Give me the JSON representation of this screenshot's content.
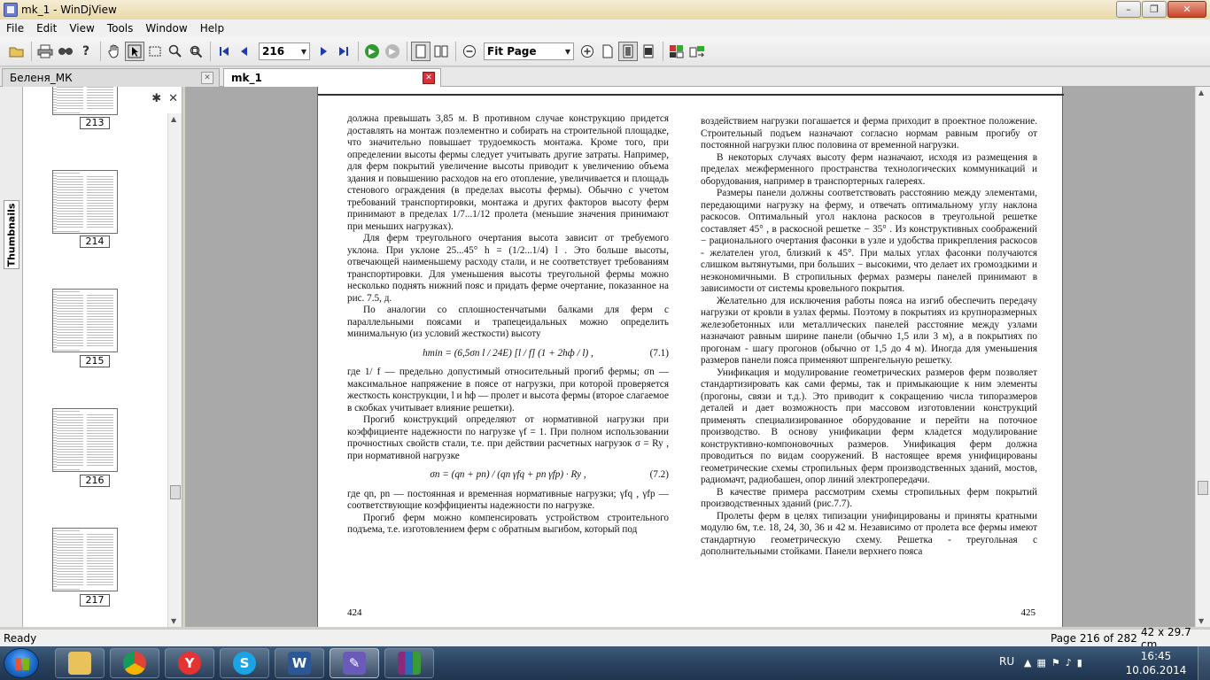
{
  "window": {
    "title": "mk_1 - WinDjView",
    "minimize": "–",
    "restore": "❐",
    "close": "✕"
  },
  "menu": [
    "File",
    "Edit",
    "View",
    "Tools",
    "Window",
    "Help"
  ],
  "toolbar": {
    "page_value": "216",
    "zoom_value": "Fit Page"
  },
  "tabs": [
    {
      "label": "Беленя_МК",
      "active": false
    },
    {
      "label": "mk_1",
      "active": true
    }
  ],
  "sidebar": {
    "tab_label": "Thumbnails",
    "thumbnails": [
      "213",
      "214",
      "215",
      "216",
      "217"
    ]
  },
  "document": {
    "left_page_number": "424",
    "right_page_number": "425",
    "left_paragraphs": [
      "должна превышать 3,85 м. В противном случае конструкцию придется доставлять на монтаж поэлементно и собирать на строительной площадке, что значительно повышает трудоемкость монтажа. Кроме того, при определении высоты фермы следует учитывать другие затраты. Например, для ферм покрытий увеличение высоты приводит к увеличению объема здания и повышению расходов на его отопление, увеличивается и площадь стенового ограждения (в пределах высоты фермы). Обычно с учетом требований транспортировки, монтажа и других факторов высоту ферм принимают в пределах 1/7...1/12 пролета (меньшие значения принимают при меньших нагрузках).",
      "Для ферм треугольного очертания высота зависит от требуемого уклона. При уклоне 25...45° h = (1/2...1/4) l . Это больше высоты, отвечающей наименьшему расходу стали, и не соответствует требованиям транспортировки. Для уменьшения высоты треугольной фермы можно несколько поднять нижний пояс и придать ферме очертание, показанное на рис. 7.5, д.",
      "По аналогии со сплошностенчатыми балками для ферм с параллельными поясами и трапецеидальных можно определить минимальную (из условий жесткости) высоту",
      "где 1/ f — предельно допустимый относительный прогиб фермы; σn — максимальное напряжение в поясе от нагрузки, при которой проверяется жесткость конструкции, l и hф — пролет и высота фермы (второе слагаемое в скобках учитывает влияние решетки).",
      "Прогиб конструкций определяют от нормативной нагрузки при коэффициенте надежности по нагрузке γf = 1. При полном использовании прочностных свойств стали, т.е. при действии расчетных нагрузок σ = Ry , при нормативной нагрузке",
      "где qn, pn — постоянная и временная нормативные нагрузки; γfq , γfp — соответствующие коэффициенты надежности по нагрузке.",
      "Прогиб ферм можно компенсировать устройством строительного подъема, т.е. изготовлением ферм с обратным выгибом, который под"
    ],
    "formula1": "hmin = (6,5σn l / 24E) [l / f] (1 + 2hф / l) ,",
    "formula1_num": "(7.1)",
    "formula2": "σn = (qn + pn) / (qn γfq + pn γfp) · Ry ,",
    "formula2_num": "(7.2)",
    "right_paragraphs": [
      "воздействием нагрузки погашается и ферма приходит в проектное положение. Строительный подъем назначают согласно нормам равным прогибу от постоянной нагрузки плюс половина от временной нагрузки.",
      "В некоторых случаях высоту ферм назначают, исходя из размещения в пределах межферменного пространства технологических коммуникаций и оборудования, например в транспортерных галереях.",
      "Размеры панели должны соответствовать расстоянию между элементами, передающими нагрузку на ферму, и отвечать оптимальному углу наклона раскосов. Оптимальный угол наклона раскосов в треугольной решетке составляет 45° , в раскосной решетке − 35° . Из конструктивных соображений − рационального очертания фасонки в узле и удобства прикрепления раскосов - желателен угол, близкий к 45°. При малых углах фасонки получаются слишком вытянутыми, при больших − высокими, что делает их громоздкими и неэкономичными. В стропильных фермах размеры панелей принимают в зависимости от системы кровельного покрытия.",
      "Желательно для исключения работы пояса на изгиб обеспечить передачу нагрузки от кровли в узлах фермы. Поэтому в покрытиях из крупноразмерных железобетонных или металлических панелей расстояние между узлами назначают равным ширине панели (обычно 1,5 или 3 м), а в покрытиях по прогонам - шагу прогонов (обычно от 1,5 до 4 м). Иногда для уменьшения размеров панели пояса применяют шпренгельную решетку.",
      "Унификация и модулирование геометрических размеров ферм позволяет стандартизировать как сами фермы, так и примыкающие к ним элементы (прогоны, связи и т.д.). Это приводит к сокращению числа типоразмеров деталей и дает возможность при массовом изготовлении конструкций применять специализированное оборудование и перейти на поточное производство. В основу унификации ферм кладется модулирование конструктивно-компоновочных размеров. Унификация ферм должна проводиться по видам сооружений. В настоящее время унифицированы геометрические схемы стропильных ферм производственных зданий, мостов, радиомачт, радиобашен, опор линий электропередачи.",
      "В качестве примера рассмотрим схемы стропильных ферм покрытий производственных зданий (рис.7.7).",
      "Пролеты ферм в целях типизации унифицированы и приняты кратными модулю 6м, т.е. 18, 24, 30, 36 и 42 м. Независимо от пролета все фермы имеют стандартную геометрическую схему. Решетка - треугольная с дополнительными стойками. Панели верхнего пояса"
    ]
  },
  "status": {
    "ready": "Ready",
    "page": "Page 216 of 282",
    "size": "42 x 29.7 cm"
  },
  "taskbar": {
    "language": "RU",
    "time": "16:45",
    "date": "10.06.2014"
  },
  "colors": {
    "taskbar": "#2a4360",
    "active_tab_close": "#d9303a",
    "title_gradient": "#efe3bf"
  }
}
